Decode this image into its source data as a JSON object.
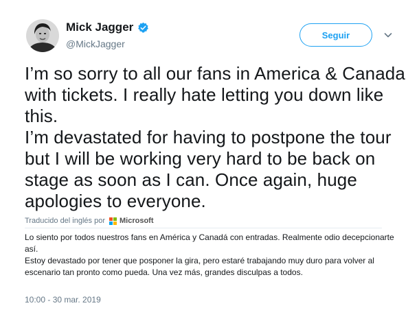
{
  "user": {
    "display_name": "Mick Jagger",
    "handle": "@MickJagger",
    "verified": true
  },
  "actions": {
    "follow_label": "Seguir",
    "more_icon": "chevron-down-icon"
  },
  "tweet": {
    "paragraphs": [
      "I’m so sorry to all our fans in America & Canada with tickets. I really hate letting you down like this.",
      "I’m devastated for having to postpone the tour but I will be working very hard to be back on stage as soon as I can. Once again, huge apologies to everyone."
    ]
  },
  "translation": {
    "credit": "Traducido del inglés por",
    "provider": "Microsoft",
    "paragraphs": [
      "Lo siento por todos nuestros fans en América y Canadá con entradas. Realmente odio decepcionarte así.",
      "Estoy devastado por tener que posponer la gira, pero estaré trabajando muy duro para volver al escenario tan pronto como pueda. Una vez más, grandes disculpas a todos."
    ]
  },
  "timestamp": "10:00 - 30 mar. 2019",
  "colors": {
    "accent": "#1da1f2",
    "secondary_text": "#657786",
    "primary_text": "#14171a",
    "ms_red": "#f25022",
    "ms_green": "#7fba00",
    "ms_blue": "#00a4ef",
    "ms_yellow": "#ffb900"
  }
}
